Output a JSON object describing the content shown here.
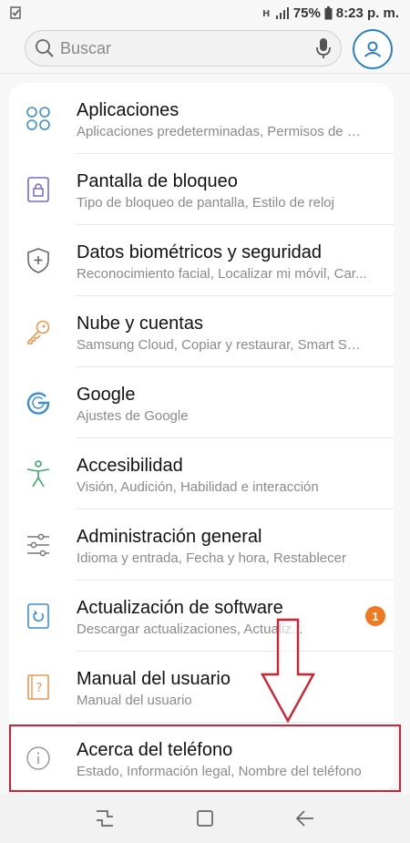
{
  "status_bar": {
    "battery": "75%",
    "time": "8:23 p. m."
  },
  "search": {
    "placeholder": "Buscar"
  },
  "settings": [
    {
      "title": "Aplicaciones",
      "subtitle": "Aplicaciones predeterminadas, Permisos de ap..."
    },
    {
      "title": "Pantalla de bloqueo",
      "subtitle": "Tipo de bloqueo de pantalla, Estilo de reloj"
    },
    {
      "title": "Datos biométricos y seguridad",
      "subtitle": "Reconocimiento facial, Localizar mi móvil, Car..."
    },
    {
      "title": "Nube y cuentas",
      "subtitle": "Samsung Cloud, Copiar y restaurar, Smart Swit..."
    },
    {
      "title": "Google",
      "subtitle": "Ajustes de Google"
    },
    {
      "title": "Accesibilidad",
      "subtitle": "Visión, Audición, Habilidad e interacción"
    },
    {
      "title": "Administración general",
      "subtitle": "Idioma y entrada, Fecha y hora, Restablecer"
    },
    {
      "title": "Actualización de software",
      "subtitle": "Descargar actualizaciones, Actualiz...",
      "badge": "1"
    },
    {
      "title": "Manual del usuario",
      "subtitle": "Manual del usuario"
    },
    {
      "title": "Acerca del teléfono",
      "subtitle": "Estado, Información legal, Nombre del teléfono"
    }
  ],
  "icons": {
    "apps": "apps-icon",
    "lock": "lock-screen-icon",
    "shield": "shield-icon",
    "key": "key-icon",
    "google": "google-icon",
    "accessibility": "accessibility-icon",
    "sliders": "sliders-icon",
    "update": "software-update-icon",
    "manual": "manual-icon",
    "info": "info-icon"
  },
  "colors": {
    "accent_blue": "#2a7fc0",
    "badge_orange": "#f07820",
    "highlight_red": "#d42030"
  }
}
